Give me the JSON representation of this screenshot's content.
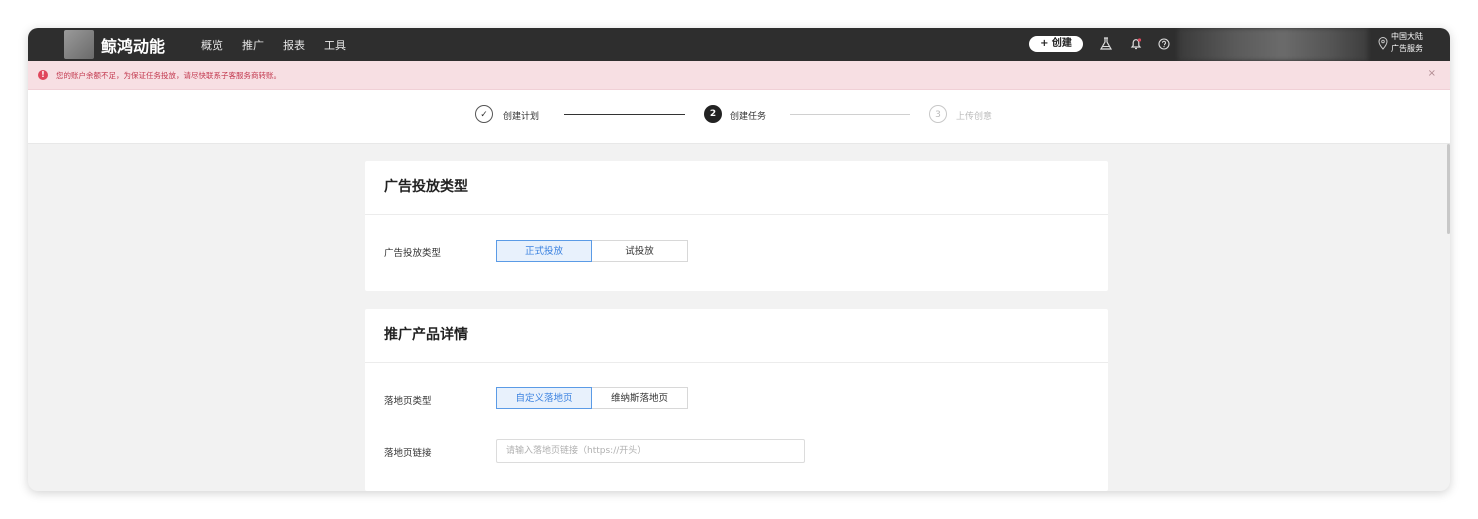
{
  "header": {
    "brand": "鲸鸿动能",
    "nav": [
      "概览",
      "推广",
      "报表",
      "工具"
    ],
    "create_label": "+ 创建",
    "icons": [
      "flask-icon",
      "bell-icon",
      "help-icon"
    ],
    "region_line1": "中国大陆",
    "region_line2": "广告服务"
  },
  "alert": {
    "text": "您的账户余额不足，为保证任务投放，请尽快联系子客服务商转账。",
    "close": "×",
    "color": "#e0475c"
  },
  "steps": [
    {
      "number": "✓",
      "label": "创建计划",
      "state": "done"
    },
    {
      "number": "2",
      "label": "创建任务",
      "state": "active"
    },
    {
      "number": "3",
      "label": "上传创意",
      "state": "pending"
    }
  ],
  "ad_type_card": {
    "title": "广告投放类型",
    "field_label": "广告投放类型",
    "options": [
      "正式投放",
      "试投放"
    ],
    "selected": "正式投放"
  },
  "product_card": {
    "title": "推广产品详情",
    "landing_type_label": "落地页类型",
    "landing_type_options": [
      "自定义落地页",
      "维纳斯落地页"
    ],
    "landing_type_selected": "自定义落地页",
    "landing_link_label": "落地页链接",
    "landing_link_value": "",
    "landing_link_placeholder": "请输入落地页链接（https://开头）"
  },
  "colors": {
    "topbar": "#2e2e2e",
    "accent": "#3b82e0",
    "alert_bg": "#f7dfe3"
  }
}
